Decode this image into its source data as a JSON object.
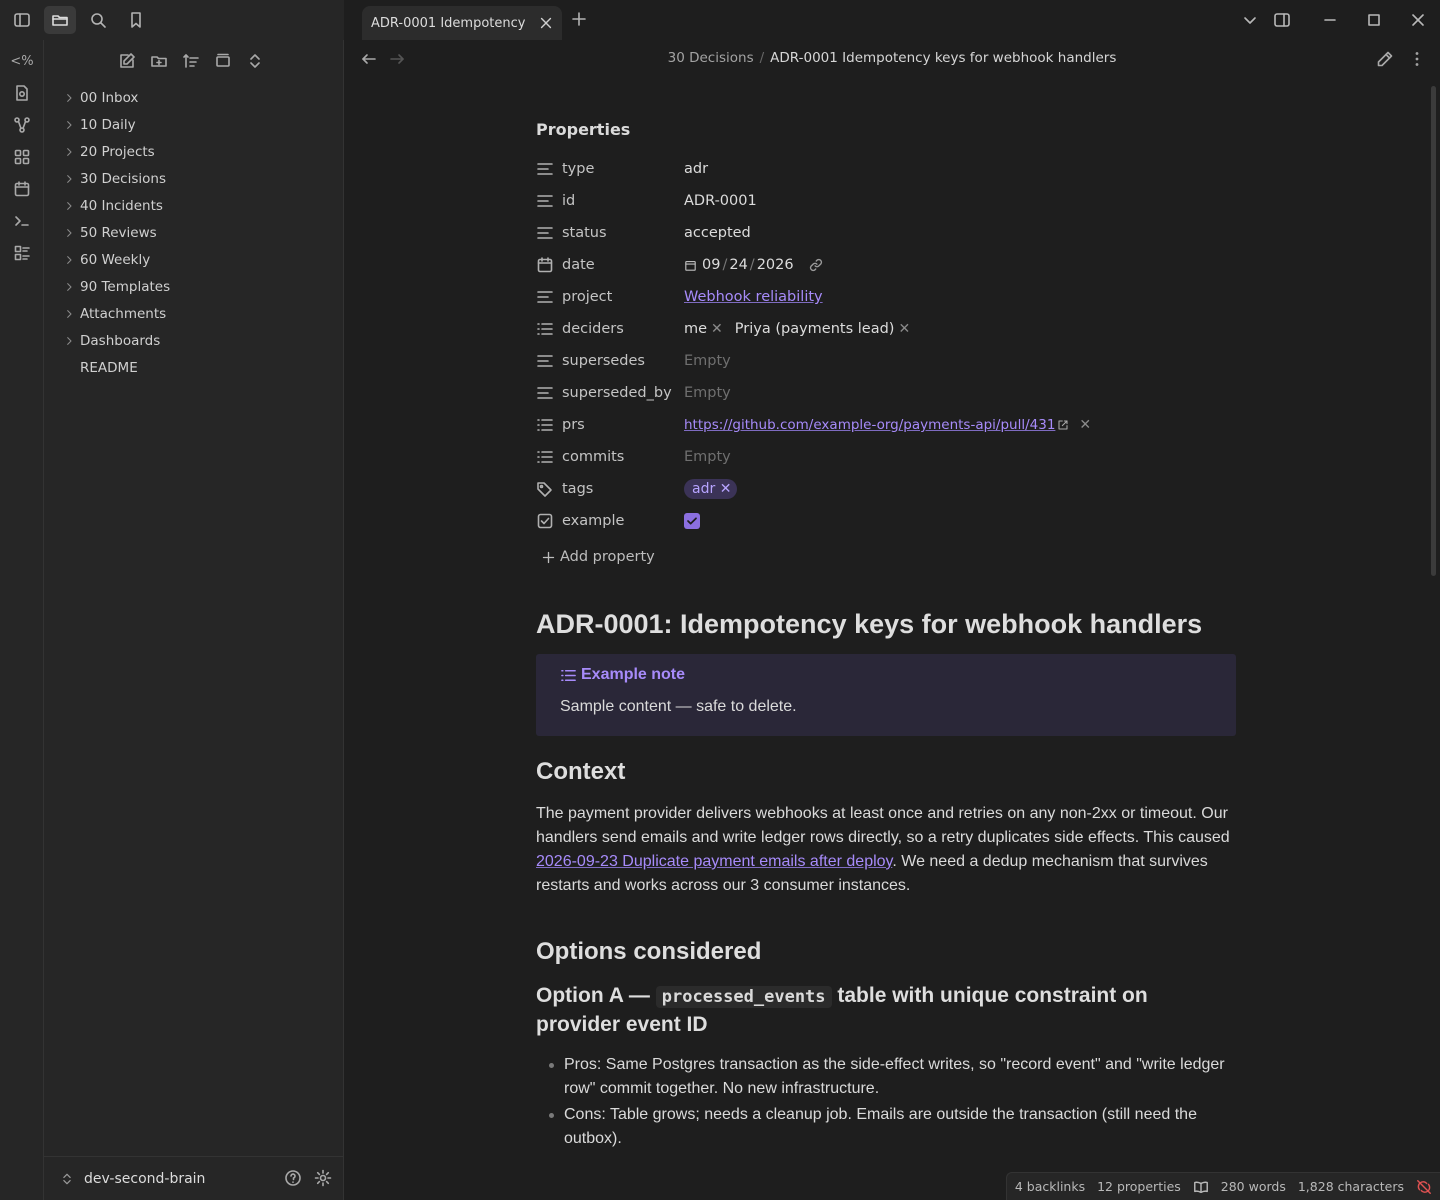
{
  "tab": {
    "title": "ADR-0001 Idempotency ..."
  },
  "ribbon": {
    "templater_label": "<%"
  },
  "explorer": {
    "items": [
      {
        "label": "00 Inbox",
        "folder": true
      },
      {
        "label": "10 Daily",
        "folder": true
      },
      {
        "label": "20 Projects",
        "folder": true
      },
      {
        "label": "30 Decisions",
        "folder": true
      },
      {
        "label": "40 Incidents",
        "folder": true
      },
      {
        "label": "50 Reviews",
        "folder": true
      },
      {
        "label": "60 Weekly",
        "folder": true
      },
      {
        "label": "90 Templates",
        "folder": true
      },
      {
        "label": "Attachments",
        "folder": true
      },
      {
        "label": "Dashboards",
        "folder": true
      },
      {
        "label": "README",
        "folder": false
      }
    ],
    "vault_name": "dev-second-brain"
  },
  "header": {
    "breadcrumb_parent": "30 Decisions",
    "breadcrumb_sep": "/",
    "breadcrumb_current": "ADR-0001 Idempotency keys for webhook handlers"
  },
  "properties": {
    "heading": "Properties",
    "type": {
      "key": "type",
      "value": "adr"
    },
    "id": {
      "key": "id",
      "value": "ADR-0001"
    },
    "status": {
      "key": "status",
      "value": "accepted"
    },
    "date": {
      "key": "date",
      "mm": "09",
      "dd": "24",
      "yyyy": "2026",
      "sep": "/"
    },
    "project": {
      "key": "project",
      "value": "Webhook reliability"
    },
    "deciders": {
      "key": "deciders",
      "values": [
        "me",
        "Priya (payments lead)"
      ]
    },
    "supersedes": {
      "key": "supersedes",
      "value": "Empty"
    },
    "superseded_by": {
      "key": "superseded_by",
      "value": "Empty"
    },
    "prs": {
      "key": "prs",
      "value": "https://github.com/example-org/payments-api/pull/431"
    },
    "commits": {
      "key": "commits",
      "value": "Empty"
    },
    "tags": {
      "key": "tags",
      "values": [
        "adr"
      ]
    },
    "example": {
      "key": "example",
      "checked": true
    },
    "add_label": "Add property"
  },
  "note": {
    "title": "ADR-0001: Idempotency keys for webhook handlers",
    "callout": {
      "title": "Example note",
      "body": "Sample content — safe to delete."
    },
    "context_heading": "Context",
    "context_p1": "The payment provider delivers webhooks at least once and retries on any non-2xx or timeout. Our handlers send emails and write ledger rows directly, so a retry duplicates side effects. This caused ",
    "context_link": "2026-09-23 Duplicate payment emails after deploy",
    "context_p2": ". We need a dedup mechanism that survives restarts and works across our 3 consumer instances.",
    "options_heading": "Options considered",
    "option_a_prefix": "Option A —",
    "option_a_code": "processed_events",
    "option_a_suffix": "table with unique constraint on provider event ID",
    "option_a_bullets": [
      "Pros: Same Postgres transaction as the side-effect writes, so \"record event\" and \"write ledger row\" commit together. No new infrastructure.",
      "Cons: Table grows; needs a cleanup job. Emails are outside the transaction (still need the outbox)."
    ]
  },
  "status": {
    "backlinks": "4 backlinks",
    "properties": "12 properties",
    "words": "280 words",
    "chars": "1,828 characters"
  },
  "colors": {
    "accent": "#a78bfa",
    "bg": "#1e1e1e",
    "panel": "#262626"
  }
}
